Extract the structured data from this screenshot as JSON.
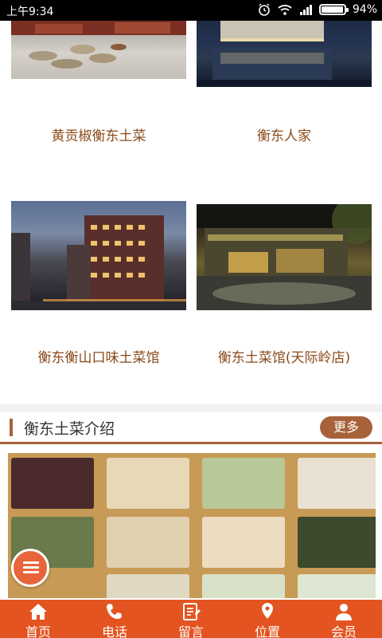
{
  "status_bar": {
    "time": "上午9:34",
    "battery": "94%"
  },
  "restaurants": [
    {
      "name": "黄贡椒衡东土菜"
    },
    {
      "name": "衡东人家"
    },
    {
      "name": "衡东衡山口味土菜馆"
    },
    {
      "name": "衡东土菜馆(天际岭店)"
    }
  ],
  "section": {
    "title": "衡东土菜介绍",
    "more_label": "更多"
  },
  "bottom_nav": [
    {
      "label": "首页",
      "icon": "home-icon"
    },
    {
      "label": "电话",
      "icon": "phone-icon"
    },
    {
      "label": "留言",
      "icon": "message-icon"
    },
    {
      "label": "位置",
      "icon": "location-icon"
    },
    {
      "label": "会员",
      "icon": "member-icon"
    }
  ],
  "colors": {
    "accent": "#e35420",
    "brown": "#a8623a",
    "name_text": "#8b4a1a"
  }
}
